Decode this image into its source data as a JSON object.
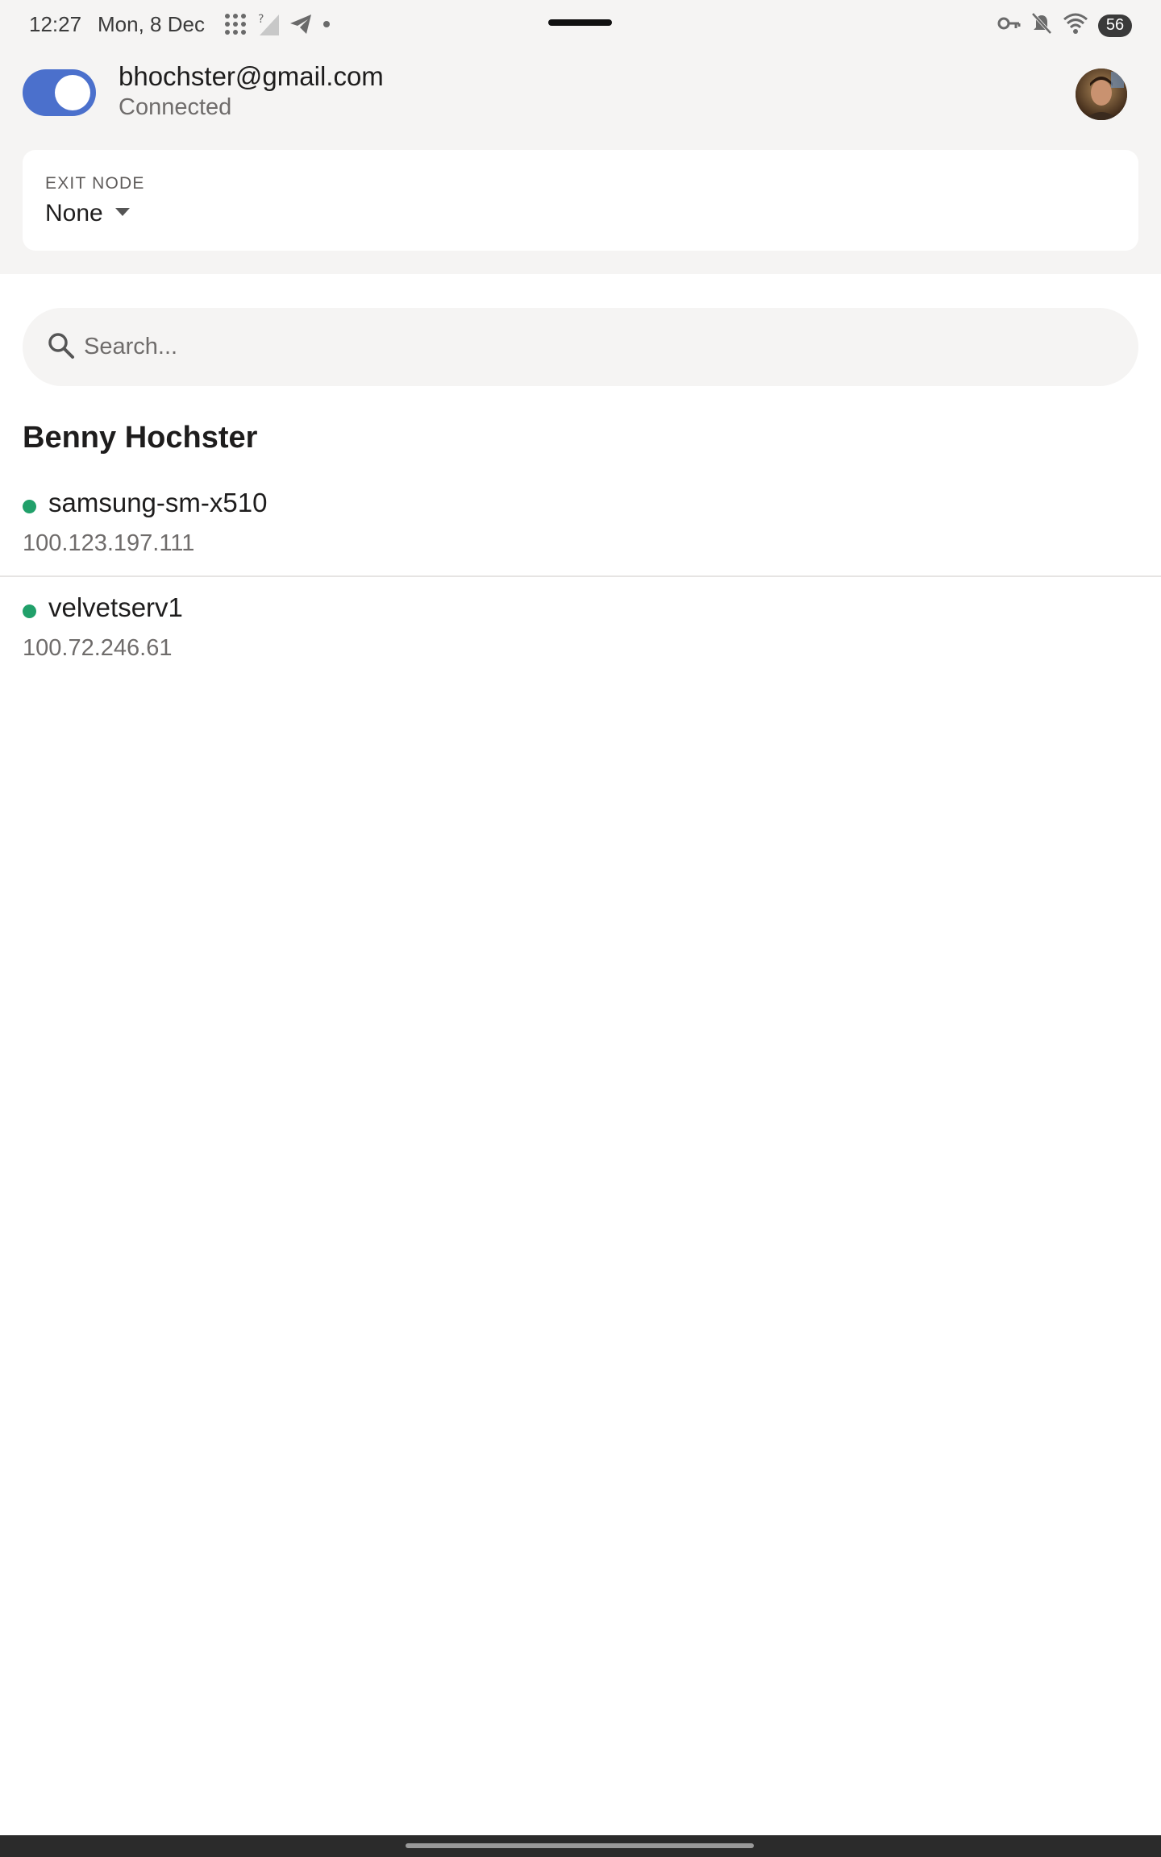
{
  "status_bar": {
    "time": "12:27",
    "date": "Mon, 8 Dec",
    "battery": "56",
    "icons_left": [
      "app-grid-icon",
      "signal-unknown-icon",
      "telegram-icon",
      "dot-icon"
    ],
    "icons_right": [
      "vpn-key-icon",
      "mute-icon",
      "wifi-icon",
      "battery-icon"
    ]
  },
  "account": {
    "vpn_enabled": true,
    "email": "bhochster@gmail.com",
    "status": "Connected"
  },
  "exit_node": {
    "label": "EXIT NODE",
    "value": "None"
  },
  "search": {
    "placeholder": "Search...",
    "value": ""
  },
  "peers": {
    "owner": "Benny Hochster",
    "items": [
      {
        "name": "samsung-sm-x510",
        "ip": "100.123.197.111",
        "online": true
      },
      {
        "name": "velvetserv1",
        "ip": "100.72.246.61",
        "online": true
      }
    ]
  },
  "colors": {
    "accent": "#4b70cc",
    "online": "#21a06a",
    "header_bg": "#f5f4f3"
  }
}
